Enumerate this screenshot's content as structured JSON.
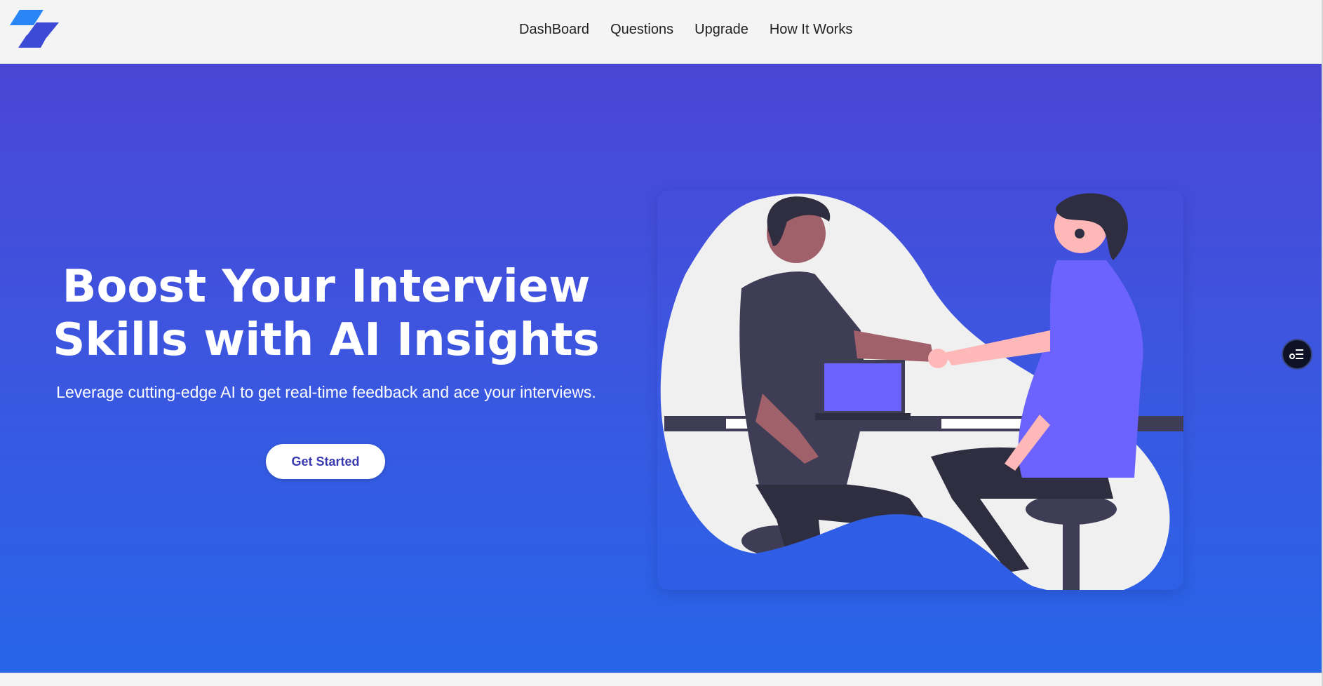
{
  "header": {
    "logo_icon": "brand-logo-icon",
    "nav": [
      {
        "label": "DashBoard"
      },
      {
        "label": "Questions"
      },
      {
        "label": "Upgrade"
      },
      {
        "label": "How It Works"
      }
    ]
  },
  "hero": {
    "title_line1": "Boost Your Interview",
    "title_line2": "Skills with AI Insights",
    "subtitle": "Leverage cutting-edge AI to get real-time feedback and ace your interviews.",
    "cta_label": "Get Started",
    "illustration": "handshake-interview-illustration"
  },
  "side_widget": {
    "icon": "filter-list-icon"
  },
  "colors": {
    "hero_top": "#4a46d4",
    "hero_bottom": "#2764e8",
    "header_bg": "#f4f4f4",
    "cta_text": "#3a3ab0",
    "accent_purple": "#6c63ff"
  }
}
